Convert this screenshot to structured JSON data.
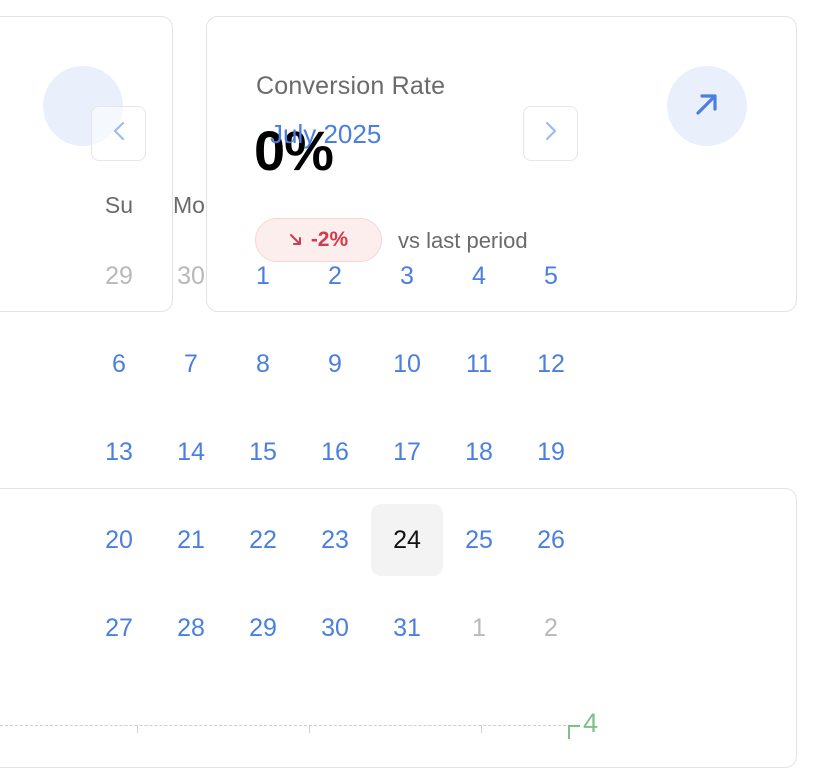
{
  "metric_card": {
    "title": "Conversion Rate",
    "value": "0%",
    "change": "-2%",
    "compare_text": "vs last period",
    "change_color": "#d33a4a",
    "accent": "#4a7fe0"
  },
  "calendar": {
    "month_label": "July 2025",
    "weekdays": [
      "Su",
      "Mo"
    ],
    "weeks": [
      [
        {
          "d": "29",
          "muted": true
        },
        {
          "d": "30",
          "muted": true
        },
        {
          "d": "1"
        },
        {
          "d": "2"
        },
        {
          "d": "3"
        },
        {
          "d": "4"
        },
        {
          "d": "5"
        }
      ],
      [
        {
          "d": "6"
        },
        {
          "d": "7"
        },
        {
          "d": "8"
        },
        {
          "d": "9"
        },
        {
          "d": "10"
        },
        {
          "d": "11"
        },
        {
          "d": "12"
        }
      ],
      [
        {
          "d": "13"
        },
        {
          "d": "14"
        },
        {
          "d": "15"
        },
        {
          "d": "16"
        },
        {
          "d": "17"
        },
        {
          "d": "18"
        },
        {
          "d": "19"
        }
      ],
      [
        {
          "d": "20"
        },
        {
          "d": "21"
        },
        {
          "d": "22"
        },
        {
          "d": "23"
        },
        {
          "d": "24",
          "selected": true
        },
        {
          "d": "25"
        },
        {
          "d": "26"
        }
      ],
      [
        {
          "d": "27"
        },
        {
          "d": "28"
        },
        {
          "d": "29"
        },
        {
          "d": "30"
        },
        {
          "d": "31"
        },
        {
          "d": "1",
          "muted": true
        },
        {
          "d": "2",
          "muted": true
        }
      ]
    ]
  },
  "chart_fragment": {
    "axis_label": "4"
  }
}
